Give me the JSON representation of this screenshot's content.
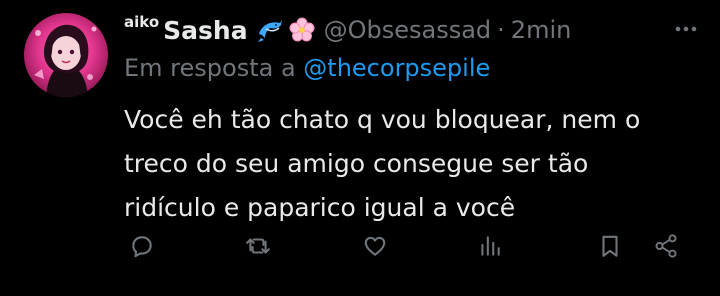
{
  "tweet": {
    "name_prefix": "aiko",
    "display_name": "Sasha",
    "handle": "@Obsesassad",
    "separator": "·",
    "time": "2min",
    "reply_prefix": "Em resposta a",
    "reply_mention": "@thecorpsepile",
    "text_lines": [
      "Você eh tão chato q vou bloquear, nem o",
      "treco do seu amigo consegue ser tão",
      "ridículo e paparico igual a você"
    ]
  },
  "icons": {
    "more": "more-icon",
    "reply": "reply-icon",
    "retweet": "retweet-icon",
    "like": "heart-icon",
    "views": "views-icon",
    "bookmark": "bookmark-icon",
    "share": "share-icon"
  },
  "colors": {
    "background": "#000000",
    "text": "#e7e9ea",
    "muted": "#71767b",
    "link": "#1d9bf0"
  }
}
